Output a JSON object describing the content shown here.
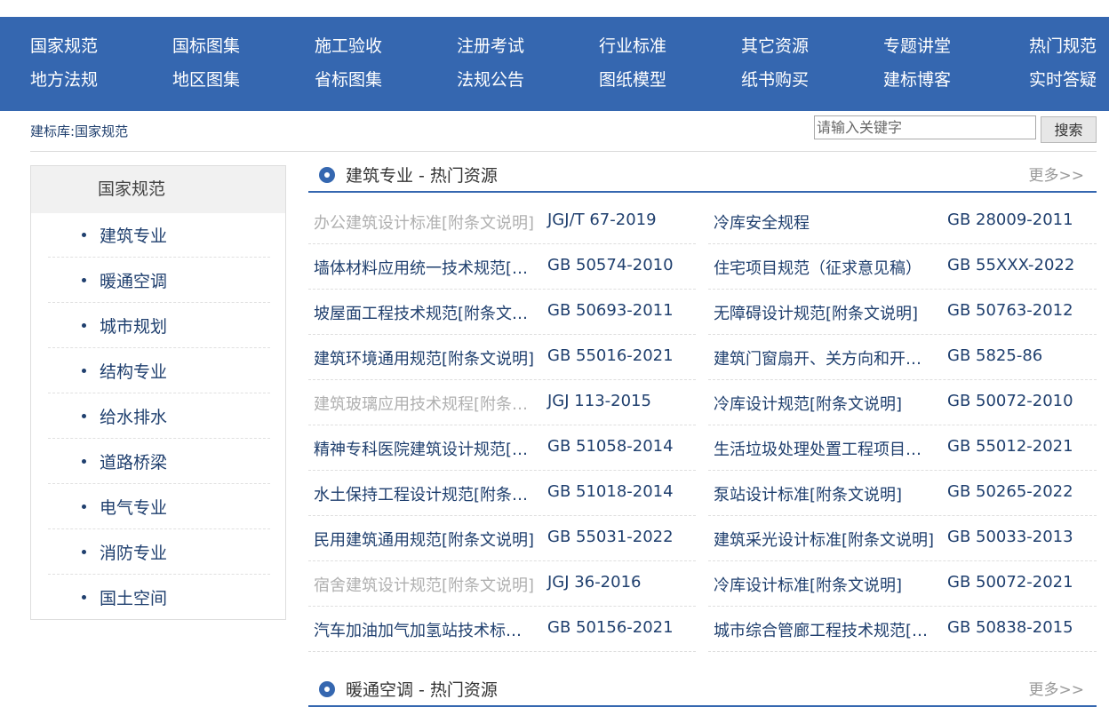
{
  "nav": {
    "row1": [
      "国家规范",
      "国标图集",
      "施工验收",
      "注册考试",
      "行业标准",
      "其它资源",
      "专题讲堂",
      "热门规范"
    ],
    "row2": [
      "地方法规",
      "地区图集",
      "省标图集",
      "法规公告",
      "图纸模型",
      "纸书购买",
      "建标博客",
      "实时答疑"
    ]
  },
  "breadcrumb": {
    "root": "建标库:",
    "current": "国家规范"
  },
  "search": {
    "placeholder": "请输入关键字",
    "button": "搜索"
  },
  "sidebar": {
    "title": "国家规范",
    "items": [
      "建筑专业",
      "暖通空调",
      "城市规划",
      "结构专业",
      "给水排水",
      "道路桥梁",
      "电气专业",
      "消防专业",
      "国土空间"
    ]
  },
  "sections": [
    {
      "title": "建筑专业 - 热门资源",
      "more": "更多>>"
    },
    {
      "title": "暖通空调 - 热门资源",
      "more": "更多>>"
    }
  ],
  "rows": [
    {
      "left": {
        "title": "办公建筑设计标准[附条文说明]",
        "code": "JGJ/T 67-2019",
        "dim": true
      },
      "right": {
        "title": "冷库安全规程",
        "code": "GB 28009-2011",
        "dim": false
      }
    },
    {
      "left": {
        "title": "墙体材料应用统一技术规范[附条文说明]",
        "code": "GB 50574-2010",
        "dim": false
      },
      "right": {
        "title": "住宅项目规范（征求意见稿）",
        "code": "GB 55XXX-2022",
        "dim": false
      }
    },
    {
      "left": {
        "title": "坡屋面工程技术规范[附条文说明]",
        "code": "GB 50693-2011",
        "dim": false
      },
      "right": {
        "title": "无障碍设计规范[附条文说明]",
        "code": "GB 50763-2012",
        "dim": false
      }
    },
    {
      "left": {
        "title": "建筑环境通用规范[附条文说明]",
        "code": "GB 55016-2021",
        "dim": false
      },
      "right": {
        "title": "建筑门窗扇开、关方向和开、关面的标注",
        "code": "GB 5825-86",
        "dim": false
      }
    },
    {
      "left": {
        "title": "建筑玻璃应用技术规程[附条文说明]",
        "code": "JGJ 113-2015",
        "dim": true
      },
      "right": {
        "title": "冷库设计规范[附条文说明]",
        "code": "GB 50072-2010",
        "dim": false
      }
    },
    {
      "left": {
        "title": "精神专科医院建筑设计规范[附条文说明]",
        "code": "GB 51058-2014",
        "dim": false
      },
      "right": {
        "title": "生活垃圾处理处置工程项目规范",
        "code": "GB 55012-2021",
        "dim": false
      }
    },
    {
      "left": {
        "title": "水土保持工程设计规范[附条文说明]",
        "code": "GB 51018-2014",
        "dim": false
      },
      "right": {
        "title": "泵站设计标准[附条文说明]",
        "code": "GB 50265-2022",
        "dim": false
      }
    },
    {
      "left": {
        "title": "民用建筑通用规范[附条文说明]",
        "code": "GB 55031-2022",
        "dim": false
      },
      "right": {
        "title": "建筑采光设计标准[附条文说明]",
        "code": "GB 50033-2013",
        "dim": false
      }
    },
    {
      "left": {
        "title": "宿舍建筑设计规范[附条文说明]",
        "code": "JGJ 36-2016",
        "dim": true
      },
      "right": {
        "title": "冷库设计标准[附条文说明]",
        "code": "GB 50072-2021",
        "dim": false
      }
    },
    {
      "left": {
        "title": "汽车加油加气加氢站技术标准[附条文说明]",
        "code": "GB 50156-2021",
        "dim": false
      },
      "right": {
        "title": "城市综合管廊工程技术规范[附条文说明]",
        "code": "GB 50838-2015",
        "dim": false
      }
    }
  ]
}
